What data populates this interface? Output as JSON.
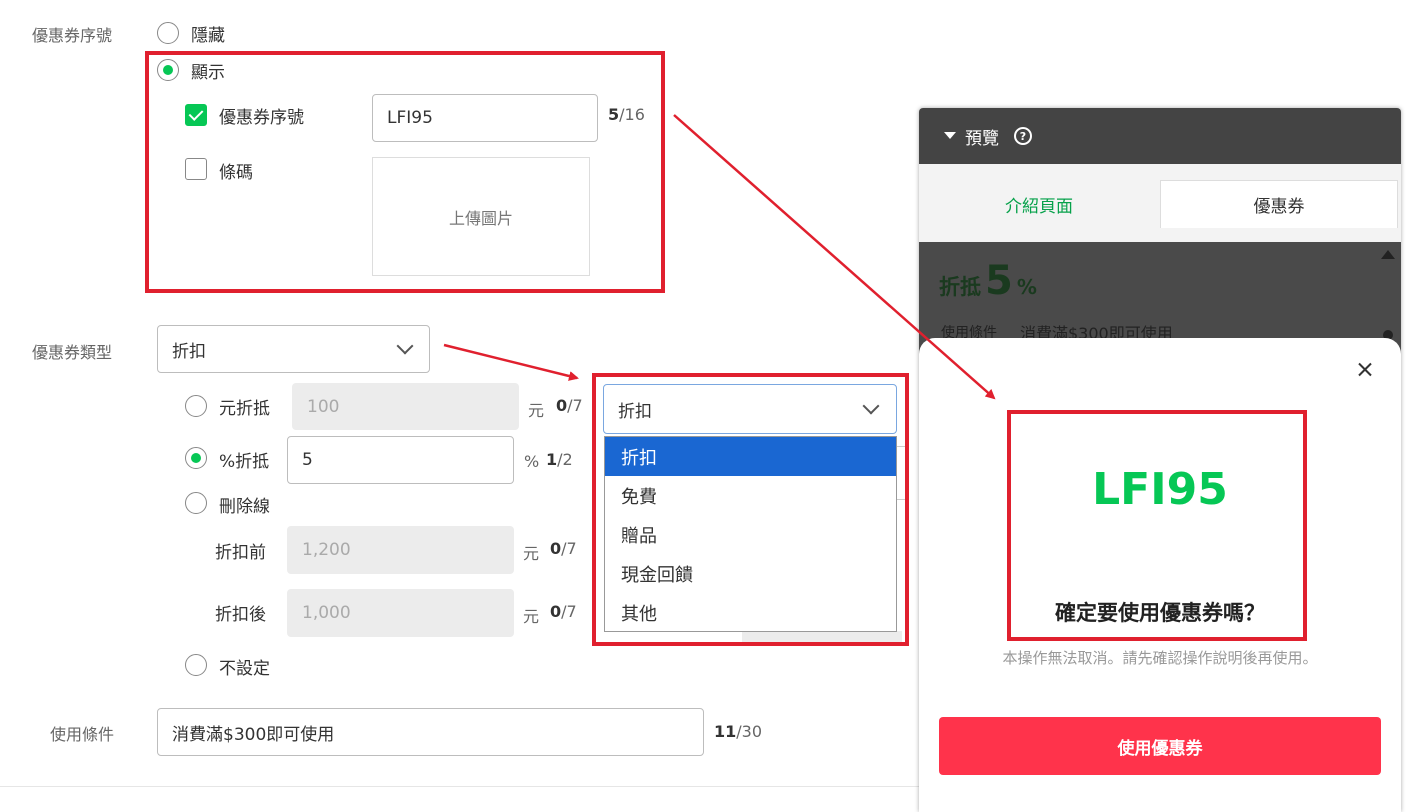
{
  "coupon_code_section": {
    "label": "優惠券序號",
    "radio_hide": "隱藏",
    "radio_show": "顯示",
    "checkbox_code": "優惠券序號",
    "code_value": "LFI95",
    "code_counter_current": "5",
    "code_counter_max": "/16",
    "checkbox_barcode": "條碼",
    "upload_label": "上傳圖片"
  },
  "coupon_type_section": {
    "label": "優惠券類型",
    "selected": "折扣",
    "option_yuan": "元折抵",
    "yuan_value": "100",
    "yuan_unit": "元",
    "yuan_counter_current": "0",
    "yuan_counter_max": "/7",
    "option_percent": "%折抵",
    "percent_value": "5",
    "percent_unit": "%",
    "percent_counter_current": "1",
    "percent_counter_max": "/2",
    "option_strike": "刪除線",
    "before_label": "折扣前",
    "before_value": "1,200",
    "before_unit": "元",
    "before_counter_current": "0",
    "before_counter_max": "/7",
    "after_label": "折扣後",
    "after_value": "1,000",
    "after_unit": "元",
    "after_counter_current": "0",
    "after_counter_max": "/7",
    "option_none": "不設定"
  },
  "dropdown": {
    "selected": "折扣",
    "options": [
      "折扣",
      "免費",
      "贈品",
      "現金回饋",
      "其他"
    ]
  },
  "usage_section": {
    "label": "使用條件",
    "value": "消費滿$300即可使用",
    "counter_current": "11",
    "counter_max": "/30"
  },
  "preview": {
    "title": "預覽",
    "tab_intro": "介紹頁面",
    "tab_coupon": "優惠券",
    "discount_prefix": "折抵",
    "discount_value": "5",
    "discount_unit": "%",
    "usage_label": "使用條件",
    "usage_value": "消費滿$300即可使用",
    "modal_code": "LFI95",
    "modal_question": "確定要使用優惠券嗎？",
    "modal_note": "本操作無法取消。請先確認操作說明後再使用。",
    "use_button": "使用優惠券"
  },
  "colors": {
    "accent_green": "#06c755",
    "highlight_red": "#e0202e",
    "button_red": "#ff334b",
    "select_blue": "#1a67d2"
  }
}
